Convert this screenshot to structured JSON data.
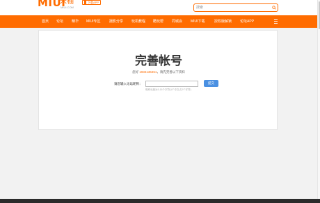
{
  "header": {
    "logo_text": "MIUI",
    "logo_cn": "米柚",
    "logo_sub": "MIUI.COM",
    "app_download": "下载APP",
    "search_placeholder": "搜索"
  },
  "nav": {
    "items": [
      {
        "label": "首页"
      },
      {
        "label": "论坛"
      },
      {
        "label": "精华"
      },
      {
        "label": "MIUI专区"
      },
      {
        "label": "摄影分享"
      },
      {
        "label": "玩机教程"
      },
      {
        "label": "酷玩帮"
      },
      {
        "label": "同城会"
      },
      {
        "label": "MIUI下载"
      },
      {
        "label": "授权版解锁"
      },
      {
        "label": "论坛APP"
      }
    ]
  },
  "main": {
    "title": "完善帐号",
    "greeting_prefix": "您好",
    "uid": "1934136451",
    "greeting_suffix": "，请先完善以下资料",
    "field_label": "请您输入论坛昵称：",
    "input_value": "",
    "submit_label": "提交",
    "hint": "昵称长度为3-15个字符(1个中文占2个字符)"
  },
  "colors": {
    "accent": "#ff6c00",
    "button": "#4a90e2"
  }
}
